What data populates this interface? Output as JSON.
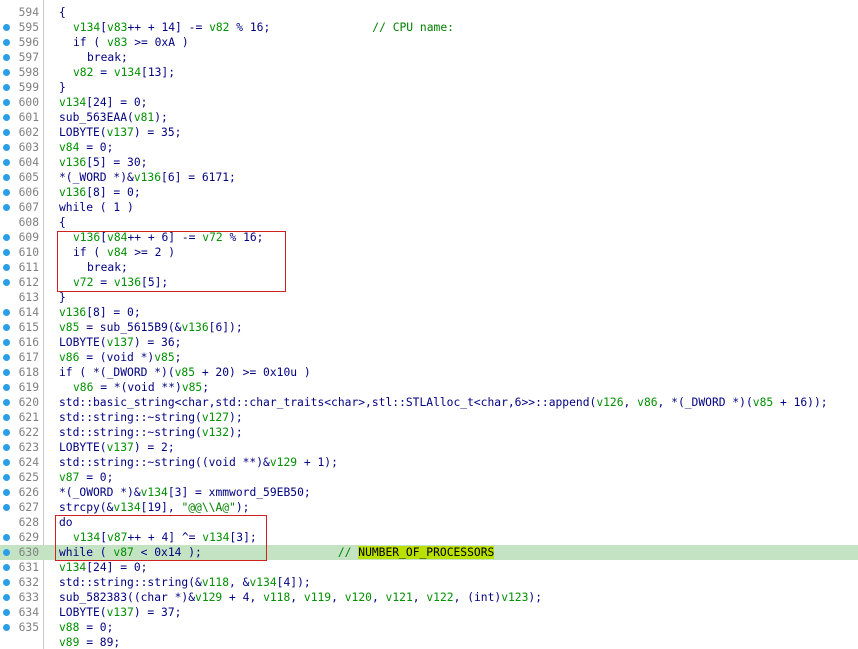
{
  "lines": [
    {
      "num": "594",
      "dot": false,
      "indent": 0,
      "tokens": [
        {
          "t": "{",
          "c": "p"
        }
      ]
    },
    {
      "num": "595",
      "dot": true,
      "indent": 1,
      "tokens": [
        {
          "t": "v134",
          "c": "v"
        },
        {
          "t": "[",
          "c": "p"
        },
        {
          "t": "v83",
          "c": "v"
        },
        {
          "t": "++ + 14] -= ",
          "c": "p"
        },
        {
          "t": "v82",
          "c": "v"
        },
        {
          "t": " % 16;",
          "c": "p"
        },
        {
          "t": "               // CPU name:",
          "c": "c"
        }
      ]
    },
    {
      "num": "596",
      "dot": true,
      "indent": 1,
      "tokens": [
        {
          "t": "if ( ",
          "c": "p"
        },
        {
          "t": "v83",
          "c": "v"
        },
        {
          "t": " >= 0xA )",
          "c": "p"
        }
      ]
    },
    {
      "num": "597",
      "dot": true,
      "indent": 2,
      "tokens": [
        {
          "t": "break;",
          "c": "p"
        }
      ]
    },
    {
      "num": "598",
      "dot": true,
      "indent": 1,
      "tokens": [
        {
          "t": "v82",
          "c": "v"
        },
        {
          "t": " = ",
          "c": "p"
        },
        {
          "t": "v134",
          "c": "v"
        },
        {
          "t": "[13];",
          "c": "p"
        }
      ]
    },
    {
      "num": "599",
      "dot": true,
      "indent": 0,
      "tokens": [
        {
          "t": "}",
          "c": "p"
        }
      ]
    },
    {
      "num": "600",
      "dot": true,
      "indent": 0,
      "tokens": [
        {
          "t": "v134",
          "c": "v"
        },
        {
          "t": "[24] = 0;",
          "c": "p"
        }
      ]
    },
    {
      "num": "601",
      "dot": true,
      "indent": 0,
      "tokens": [
        {
          "t": "sub_563EAA(",
          "c": "p"
        },
        {
          "t": "v81",
          "c": "v"
        },
        {
          "t": ");",
          "c": "p"
        }
      ]
    },
    {
      "num": "602",
      "dot": true,
      "indent": 0,
      "tokens": [
        {
          "t": "LOBYTE(",
          "c": "p"
        },
        {
          "t": "v137",
          "c": "v"
        },
        {
          "t": ") = 35;",
          "c": "p"
        }
      ]
    },
    {
      "num": "603",
      "dot": true,
      "indent": 0,
      "tokens": [
        {
          "t": "v84",
          "c": "v"
        },
        {
          "t": " = 0;",
          "c": "p"
        }
      ]
    },
    {
      "num": "604",
      "dot": true,
      "indent": 0,
      "tokens": [
        {
          "t": "v136",
          "c": "v"
        },
        {
          "t": "[5] = 30;",
          "c": "p"
        }
      ]
    },
    {
      "num": "605",
      "dot": true,
      "indent": 0,
      "tokens": [
        {
          "t": "*(_WORD *)&",
          "c": "p"
        },
        {
          "t": "v136",
          "c": "v"
        },
        {
          "t": "[6] = 6171;",
          "c": "p"
        }
      ]
    },
    {
      "num": "606",
      "dot": true,
      "indent": 0,
      "tokens": [
        {
          "t": "v136",
          "c": "v"
        },
        {
          "t": "[8] = 0;",
          "c": "p"
        }
      ]
    },
    {
      "num": "607",
      "dot": true,
      "indent": 0,
      "tokens": [
        {
          "t": "while ( 1 )",
          "c": "p"
        }
      ]
    },
    {
      "num": "608",
      "dot": false,
      "indent": 0,
      "tokens": [
        {
          "t": "{",
          "c": "p"
        }
      ]
    },
    {
      "num": "609",
      "dot": true,
      "indent": 1,
      "tokens": [
        {
          "t": "v136",
          "c": "v"
        },
        {
          "t": "[",
          "c": "p"
        },
        {
          "t": "v84",
          "c": "v"
        },
        {
          "t": "++ + 6] -= ",
          "c": "p"
        },
        {
          "t": "v72",
          "c": "v"
        },
        {
          "t": " % 16;",
          "c": "p"
        }
      ]
    },
    {
      "num": "610",
      "dot": true,
      "indent": 1,
      "tokens": [
        {
          "t": "if ( ",
          "c": "p"
        },
        {
          "t": "v84",
          "c": "v"
        },
        {
          "t": " >= 2 )",
          "c": "p"
        }
      ]
    },
    {
      "num": "611",
      "dot": true,
      "indent": 2,
      "tokens": [
        {
          "t": "break;",
          "c": "p"
        }
      ]
    },
    {
      "num": "612",
      "dot": true,
      "indent": 1,
      "tokens": [
        {
          "t": "v72",
          "c": "v"
        },
        {
          "t": " = ",
          "c": "p"
        },
        {
          "t": "v136",
          "c": "v"
        },
        {
          "t": "[5];",
          "c": "p"
        }
      ]
    },
    {
      "num": "613",
      "dot": false,
      "indent": 0,
      "tokens": [
        {
          "t": "}",
          "c": "p"
        }
      ]
    },
    {
      "num": "614",
      "dot": true,
      "indent": 0,
      "tokens": [
        {
          "t": "v136",
          "c": "v"
        },
        {
          "t": "[8] = 0;",
          "c": "p"
        }
      ]
    },
    {
      "num": "615",
      "dot": true,
      "indent": 0,
      "tokens": [
        {
          "t": "v85",
          "c": "v"
        },
        {
          "t": " = sub_5615B9(&",
          "c": "p"
        },
        {
          "t": "v136",
          "c": "v"
        },
        {
          "t": "[6]);",
          "c": "p"
        }
      ]
    },
    {
      "num": "616",
      "dot": true,
      "indent": 0,
      "tokens": [
        {
          "t": "LOBYTE(",
          "c": "p"
        },
        {
          "t": "v137",
          "c": "v"
        },
        {
          "t": ") = 36;",
          "c": "p"
        }
      ]
    },
    {
      "num": "617",
      "dot": true,
      "indent": 0,
      "tokens": [
        {
          "t": "v86",
          "c": "v"
        },
        {
          "t": " = (void *)",
          "c": "p"
        },
        {
          "t": "v85",
          "c": "v"
        },
        {
          "t": ";",
          "c": "p"
        }
      ]
    },
    {
      "num": "618",
      "dot": true,
      "indent": 0,
      "tokens": [
        {
          "t": "if ( *(_DWORD *)(",
          "c": "p"
        },
        {
          "t": "v85",
          "c": "v"
        },
        {
          "t": " + 20) >= 0x10u )",
          "c": "p"
        }
      ]
    },
    {
      "num": "619",
      "dot": true,
      "indent": 1,
      "tokens": [
        {
          "t": "v86",
          "c": "v"
        },
        {
          "t": " = *(void **)",
          "c": "p"
        },
        {
          "t": "v85",
          "c": "v"
        },
        {
          "t": ";",
          "c": "p"
        }
      ]
    },
    {
      "num": "620",
      "dot": true,
      "indent": 0,
      "tokens": [
        {
          "t": "std::basic_string<char,std::char_traits<char>,stl::STLAlloc_t<char,6>>::append(",
          "c": "p"
        },
        {
          "t": "v126",
          "c": "v"
        },
        {
          "t": ", ",
          "c": "p"
        },
        {
          "t": "v86",
          "c": "v"
        },
        {
          "t": ", *(_DWORD *)(",
          "c": "p"
        },
        {
          "t": "v85",
          "c": "v"
        },
        {
          "t": " + 16));",
          "c": "p"
        }
      ]
    },
    {
      "num": "621",
      "dot": true,
      "indent": 0,
      "tokens": [
        {
          "t": "std::string::~string(",
          "c": "p"
        },
        {
          "t": "v127",
          "c": "v"
        },
        {
          "t": ");",
          "c": "p"
        }
      ]
    },
    {
      "num": "622",
      "dot": true,
      "indent": 0,
      "tokens": [
        {
          "t": "std::string::~string(",
          "c": "p"
        },
        {
          "t": "v132",
          "c": "v"
        },
        {
          "t": ");",
          "c": "p"
        }
      ]
    },
    {
      "num": "623",
      "dot": true,
      "indent": 0,
      "tokens": [
        {
          "t": "LOBYTE(",
          "c": "p"
        },
        {
          "t": "v137",
          "c": "v"
        },
        {
          "t": ") = 2;",
          "c": "p"
        }
      ]
    },
    {
      "num": "624",
      "dot": true,
      "indent": 0,
      "tokens": [
        {
          "t": "std::string::~string((void **)&",
          "c": "p"
        },
        {
          "t": "v129",
          "c": "v"
        },
        {
          "t": " + 1);",
          "c": "p"
        }
      ]
    },
    {
      "num": "625",
      "dot": true,
      "indent": 0,
      "tokens": [
        {
          "t": "v87",
          "c": "v"
        },
        {
          "t": " = 0;",
          "c": "p"
        }
      ]
    },
    {
      "num": "626",
      "dot": true,
      "indent": 0,
      "tokens": [
        {
          "t": "*(_OWORD *)&",
          "c": "p"
        },
        {
          "t": "v134",
          "c": "v"
        },
        {
          "t": "[3] = xmmword_59EB50;",
          "c": "p"
        }
      ]
    },
    {
      "num": "627",
      "dot": true,
      "indent": 0,
      "tokens": [
        {
          "t": "strcpy(&",
          "c": "p"
        },
        {
          "t": "v134",
          "c": "v"
        },
        {
          "t": "[19], ",
          "c": "p"
        },
        {
          "t": "\"@@\\\\A@\"",
          "c": "s"
        },
        {
          "t": ");",
          "c": "p"
        }
      ]
    },
    {
      "num": "628",
      "dot": false,
      "indent": 0,
      "tokens": [
        {
          "t": "do",
          "c": "p"
        }
      ]
    },
    {
      "num": "629",
      "dot": true,
      "indent": 1,
      "tokens": [
        {
          "t": "v134",
          "c": "v"
        },
        {
          "t": "[",
          "c": "p"
        },
        {
          "t": "v87",
          "c": "v"
        },
        {
          "t": "++ + 4] ^= ",
          "c": "p"
        },
        {
          "t": "v134",
          "c": "v"
        },
        {
          "t": "[3];",
          "c": "p"
        }
      ]
    },
    {
      "num": "630",
      "dot": true,
      "indent": 0,
      "hl": true,
      "tokens": [
        {
          "t": "while ( ",
          "c": "p"
        },
        {
          "t": "v87",
          "c": "v"
        },
        {
          "t": " < 0x14 );",
          "c": "p"
        },
        {
          "t": "                    // ",
          "c": "c"
        },
        {
          "t": "NUMBER_OF_PROCESSORS",
          "c": "h"
        }
      ]
    },
    {
      "num": "631",
      "dot": true,
      "indent": 0,
      "tokens": [
        {
          "t": "v134",
          "c": "v"
        },
        {
          "t": "[24] = 0;",
          "c": "p"
        }
      ]
    },
    {
      "num": "632",
      "dot": true,
      "indent": 0,
      "tokens": [
        {
          "t": "std::string::string(&",
          "c": "p"
        },
        {
          "t": "v118",
          "c": "v"
        },
        {
          "t": ", &",
          "c": "p"
        },
        {
          "t": "v134",
          "c": "v"
        },
        {
          "t": "[4]);",
          "c": "p"
        }
      ]
    },
    {
      "num": "633",
      "dot": true,
      "indent": 0,
      "tokens": [
        {
          "t": "sub_582383((char *)&",
          "c": "p"
        },
        {
          "t": "v129",
          "c": "v"
        },
        {
          "t": " + 4, ",
          "c": "p"
        },
        {
          "t": "v118",
          "c": "v"
        },
        {
          "t": ", ",
          "c": "p"
        },
        {
          "t": "v119",
          "c": "v"
        },
        {
          "t": ", ",
          "c": "p"
        },
        {
          "t": "v120",
          "c": "v"
        },
        {
          "t": ", ",
          "c": "p"
        },
        {
          "t": "v121",
          "c": "v"
        },
        {
          "t": ", ",
          "c": "p"
        },
        {
          "t": "v122",
          "c": "v"
        },
        {
          "t": ", (int)",
          "c": "p"
        },
        {
          "t": "v123",
          "c": "v"
        },
        {
          "t": ");",
          "c": "p"
        }
      ]
    },
    {
      "num": "634",
      "dot": true,
      "indent": 0,
      "tokens": [
        {
          "t": "LOBYTE(",
          "c": "p"
        },
        {
          "t": "v137",
          "c": "v"
        },
        {
          "t": ") = 37;",
          "c": "p"
        }
      ]
    },
    {
      "num": "635",
      "dot": true,
      "indent": 0,
      "tokens": [
        {
          "t": "v88",
          "c": "v"
        },
        {
          "t": " = 0;",
          "c": "p"
        }
      ]
    },
    {
      "num": "",
      "dot": false,
      "indent": 0,
      "tokens": [
        {
          "t": "v89",
          "c": "v"
        },
        {
          "t": " = 89;",
          "c": "p"
        }
      ]
    }
  ],
  "colors": {
    "keyword_text": "#000080",
    "variable": "#009000",
    "comment": "#008000",
    "line_number": "#808080",
    "breakpoint_dot": "#2a9ee6",
    "current_line_bg": "#c3e3c3",
    "search_hit_bg": "#b9e000",
    "annotation_box": "#d02020"
  }
}
